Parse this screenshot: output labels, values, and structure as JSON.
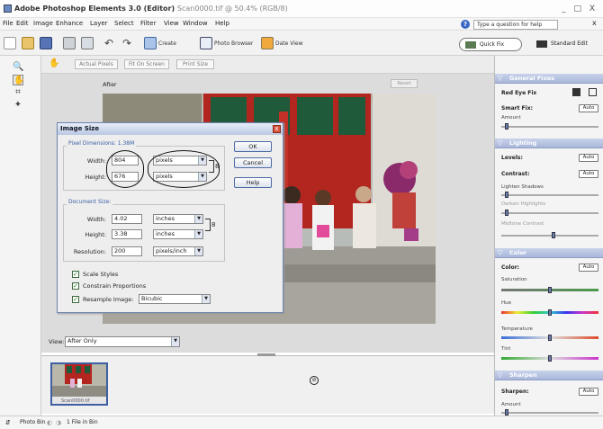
{
  "window": {
    "title_bold": "Adobe Photoshop Elements 3.0 (Editor)",
    "title_file": "Scan0000.tif @ 50.4% (RGB/8)",
    "controls": "_ □ X"
  },
  "menu": [
    "File",
    "Edit",
    "Image",
    "Enhance",
    "Layer",
    "Select",
    "Filter",
    "View",
    "Window",
    "Help"
  ],
  "help": {
    "placeholder": "Type a question for help",
    "close": "x"
  },
  "toolbar": {
    "create_label": "Create",
    "photo_browser_label": "Photo Browser",
    "date_view_label": "Date View",
    "quick_fix_label": "Quick Fix",
    "standard_edit_label": "Standard Edit"
  },
  "options": {
    "actual_pixels": "Actual Pixels",
    "fit_on_screen": "Fit On Screen",
    "print_size": "Print Size"
  },
  "preview": {
    "after_label": "After",
    "reset": "Reset"
  },
  "dialog": {
    "title": "Image Size",
    "close": "x",
    "pixel_dimensions": "Pixel Dimensions: 1.38M",
    "width_label": "Width:",
    "width_value": "804",
    "width_unit": "pixels",
    "height_label": "Height:",
    "height_value": "676",
    "height_unit": "pixels",
    "ok": "OK",
    "cancel": "Cancel",
    "help": "Help",
    "document_size": "Document Size:",
    "doc_width_label": "Width:",
    "doc_width_value": "4.02",
    "doc_width_unit": "inches",
    "doc_height_label": "Height:",
    "doc_height_value": "3.38",
    "doc_height_unit": "inches",
    "resolution_label": "Resolution:",
    "resolution_value": "200",
    "resolution_unit": "pixels/inch",
    "scale_styles": "Scale Styles",
    "constrain": "Constrain Proportions",
    "resample": "Resample Image:",
    "resample_method": "Bicubic"
  },
  "view": {
    "label": "View:",
    "value": "After Only"
  },
  "bin": {
    "thumb_caption": "Scan0000.tif"
  },
  "status": {
    "photo_bin": "Photo Bin",
    "file_in_bin": "1 File in Bin"
  },
  "palette": {
    "general_fixes": {
      "title": "General Fixes",
      "redeye": "Red Eye Fix",
      "smart_fix": "Smart Fix:",
      "auto": "Auto",
      "amount": "Amount"
    },
    "lighting": {
      "title": "Lighting",
      "levels": "Levels:",
      "contrast": "Contrast:",
      "auto": "Auto",
      "lighten_shadows": "Lighten Shadows",
      "darken_highlights": "Darken Highlights",
      "midtone_contrast": "Midtone Contrast"
    },
    "color": {
      "title": "Color",
      "color": "Color:",
      "auto": "Auto",
      "saturation": "Saturation",
      "hue": "Hue",
      "temperature": "Temperature",
      "tint": "Tint"
    },
    "sharpen": {
      "title": "Sharpen",
      "sharpen": "Sharpen:",
      "auto": "Auto",
      "amount": "Amount"
    }
  }
}
